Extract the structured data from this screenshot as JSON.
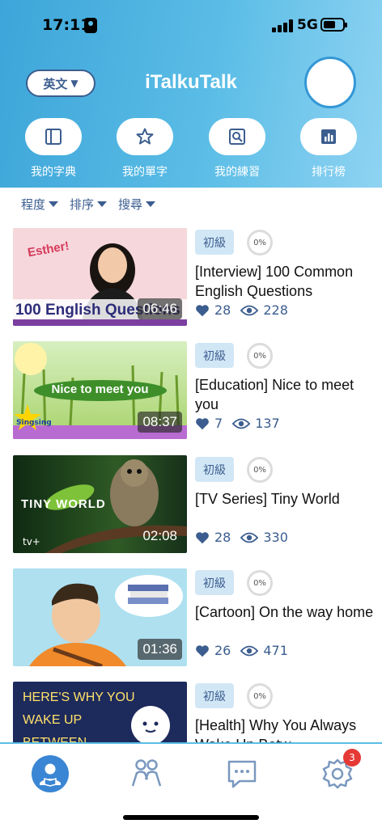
{
  "status": {
    "time": "17:11",
    "network": "5G"
  },
  "header": {
    "title": "iTalkuTalk",
    "lang_label": "英文",
    "quick": [
      {
        "label": "我的字典",
        "icon": "dictionary-icon"
      },
      {
        "label": "我的單字",
        "icon": "star-icon"
      },
      {
        "label": "我的練習",
        "icon": "search-doc-icon"
      },
      {
        "label": "排行榜",
        "icon": "leaderboard-icon"
      }
    ]
  },
  "filters": [
    {
      "label": "程度"
    },
    {
      "label": "排序"
    },
    {
      "label": "搜尋"
    }
  ],
  "videos": [
    {
      "level": "初級",
      "progress": "0%",
      "title": "[Interview] 100 Common English Questions",
      "likes": "28",
      "views": "228",
      "duration": "06:46",
      "thumb_text": "100 English Questions",
      "thumb_tag": "Esther!"
    },
    {
      "level": "初級",
      "progress": "0%",
      "title": "[Education] Nice to meet you",
      "likes": "7",
      "views": "137",
      "duration": "08:37",
      "thumb_text": "Nice to meet you",
      "thumb_tag": "Singsing"
    },
    {
      "level": "初級",
      "progress": "0%",
      "title": "[TV Series] Tiny World",
      "likes": "28",
      "views": "330",
      "duration": "02:08",
      "thumb_text": "TINY WORLD",
      "thumb_tag": "tv+"
    },
    {
      "level": "初級",
      "progress": "0%",
      "title": "[Cartoon] On the way home",
      "likes": "26",
      "views": "471",
      "duration": "01:36",
      "thumb_text": "",
      "thumb_tag": ""
    },
    {
      "level": "初級",
      "progress": "0%",
      "title": "[Health] Why You Always Wake Up Betw",
      "likes": "",
      "views": "",
      "duration": "",
      "thumb_text": "HERE'S WHY YOU WAKE UP BETWEEN",
      "thumb_tag": ""
    }
  ],
  "tabbar": {
    "items": [
      {
        "icon": "profile-book-icon"
      },
      {
        "icon": "people-icon"
      },
      {
        "icon": "chat-icon"
      },
      {
        "icon": "settings-icon"
      }
    ],
    "badge": "3"
  }
}
